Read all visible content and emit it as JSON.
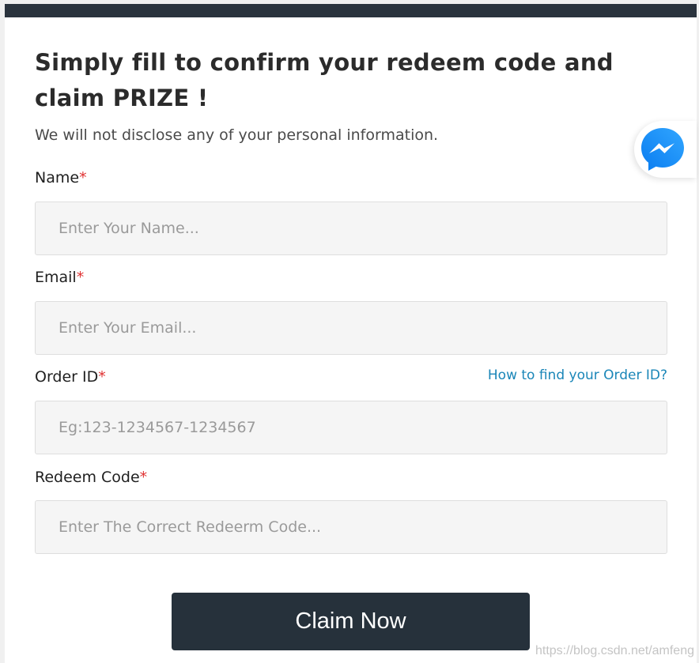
{
  "form": {
    "title": "Simply fill to confirm your redeem code and claim PRIZE !",
    "subtitle": "We will not disclose any of your personal information.",
    "required_mark": "*",
    "fields": {
      "name": {
        "label": "Name",
        "placeholder": "Enter Your Name...",
        "value": ""
      },
      "email": {
        "label": "Email",
        "placeholder": "Enter Your Email...",
        "value": ""
      },
      "order_id": {
        "label": "Order ID",
        "placeholder": "Eg:123-1234567-1234567",
        "value": "",
        "help_link": "How to find your Order ID?"
      },
      "redeem_code": {
        "label": "Redeem Code",
        "placeholder": "Enter The Correct Redeerm Code...",
        "value": ""
      }
    },
    "submit_label": "Claim Now"
  },
  "widgets": {
    "messenger_icon": "messenger-icon"
  },
  "watermark": "https://blog.csdn.net/amfeng",
  "colors": {
    "header_bar": "#2a333d",
    "button": "#26313b",
    "link": "#1a86b8",
    "required": "#e03131",
    "messenger": "#1e8cf2"
  }
}
